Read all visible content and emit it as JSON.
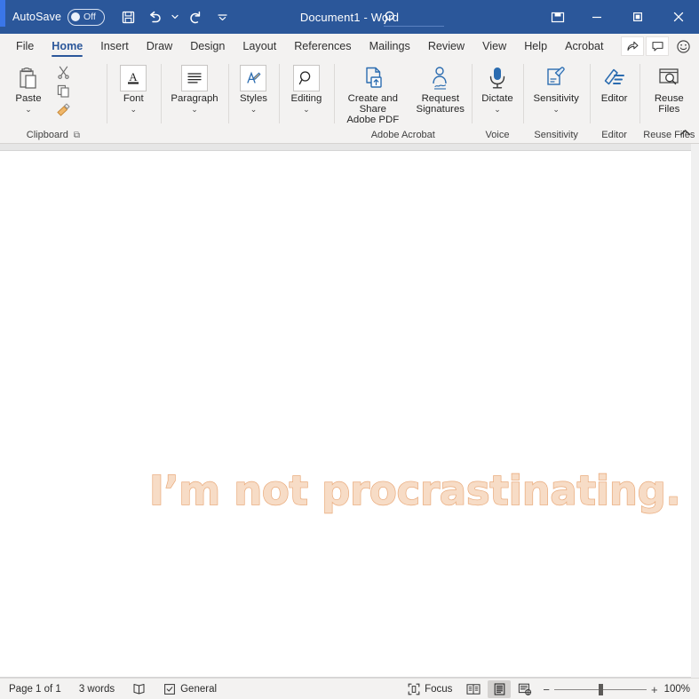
{
  "titlebar": {
    "autosave_label": "AutoSave",
    "autosave_state": "Off",
    "document_title": "Document1  -  Word",
    "quick_access": [
      {
        "name": "save-button",
        "icon": "save-icon"
      },
      {
        "name": "undo-button",
        "icon": "undo-icon"
      },
      {
        "name": "redo-button",
        "icon": "redo-icon"
      },
      {
        "name": "customize-quick-access-button",
        "icon": "chevron-down-icon"
      }
    ],
    "search_icon": "search-icon",
    "window_controls": [
      {
        "name": "ribbon-display-options-button",
        "icon": "ribbon-display-icon"
      },
      {
        "name": "minimize-button",
        "icon": "minimize-icon"
      },
      {
        "name": "maximize-button",
        "icon": "maximize-icon"
      },
      {
        "name": "close-button",
        "icon": "close-icon"
      }
    ]
  },
  "tabs": [
    {
      "label": "File",
      "active": false
    },
    {
      "label": "Home",
      "active": true
    },
    {
      "label": "Insert",
      "active": false
    },
    {
      "label": "Draw",
      "active": false
    },
    {
      "label": "Design",
      "active": false
    },
    {
      "label": "Layout",
      "active": false
    },
    {
      "label": "References",
      "active": false
    },
    {
      "label": "Mailings",
      "active": false
    },
    {
      "label": "Review",
      "active": false
    },
    {
      "label": "View",
      "active": false
    },
    {
      "label": "Help",
      "active": false
    },
    {
      "label": "Acrobat",
      "active": false
    }
  ],
  "tabbar_right": [
    {
      "name": "share-button",
      "icon": "share-icon"
    },
    {
      "name": "comments-button",
      "icon": "comment-icon"
    },
    {
      "name": "feedback-button",
      "icon": "smiley-icon"
    }
  ],
  "ribbon": {
    "collapse_icon": "chevron-up-icon",
    "groups": [
      {
        "name": "clipboard",
        "label": "Clipboard",
        "launcher": true,
        "buttons": [
          {
            "name": "paste-button",
            "label": "Paste",
            "icon": "paste-icon",
            "caret": true
          },
          {
            "name": "cut-button",
            "label": "",
            "icon": "scissors-icon",
            "caret": false
          },
          {
            "name": "copy-button",
            "label": "",
            "icon": "copy-icon",
            "caret": false
          },
          {
            "name": "format-painter-button",
            "label": "",
            "icon": "format-painter-icon",
            "caret": false
          }
        ]
      },
      {
        "name": "font",
        "label": "",
        "launcher": false,
        "buttons": [
          {
            "name": "font-group-button",
            "label": "Font",
            "icon": "font-a-icon",
            "caret": true
          }
        ]
      },
      {
        "name": "paragraph",
        "label": "",
        "launcher": false,
        "buttons": [
          {
            "name": "paragraph-group-button",
            "label": "Paragraph",
            "icon": "paragraph-lines-icon",
            "caret": true
          }
        ]
      },
      {
        "name": "styles",
        "label": "",
        "launcher": false,
        "buttons": [
          {
            "name": "styles-group-button",
            "label": "Styles",
            "icon": "styles-pen-icon",
            "caret": true
          }
        ]
      },
      {
        "name": "editing",
        "label": "",
        "launcher": false,
        "buttons": [
          {
            "name": "editing-group-button",
            "label": "Editing",
            "icon": "magnifier-icon",
            "caret": true
          }
        ]
      },
      {
        "name": "adobe-acrobat",
        "label": "Adobe Acrobat",
        "launcher": false,
        "buttons": [
          {
            "name": "create-and-share-adobe-pdf-button",
            "label": "Create and Share\nAdobe PDF",
            "icon": "pdf-upload-icon",
            "caret": false
          },
          {
            "name": "request-signatures-button",
            "label": "Request\nSignatures",
            "icon": "signature-person-icon",
            "caret": false
          }
        ]
      },
      {
        "name": "voice",
        "label": "Voice",
        "launcher": false,
        "buttons": [
          {
            "name": "dictate-button",
            "label": "Dictate",
            "icon": "microphone-icon",
            "caret": true
          }
        ]
      },
      {
        "name": "sensitivity",
        "label": "Sensitivity",
        "launcher": false,
        "buttons": [
          {
            "name": "sensitivity-button",
            "label": "Sensitivity",
            "icon": "sensitivity-tag-icon",
            "caret": true
          }
        ]
      },
      {
        "name": "editor",
        "label": "Editor",
        "launcher": false,
        "buttons": [
          {
            "name": "editor-button",
            "label": "Editor",
            "icon": "editor-pen-icon",
            "caret": false
          }
        ]
      },
      {
        "name": "reuse-files",
        "label": "Reuse Files",
        "launcher": false,
        "buttons": [
          {
            "name": "reuse-files-button",
            "label": "Reuse\nFiles",
            "icon": "reuse-files-icon",
            "caret": false
          }
        ]
      }
    ]
  },
  "document": {
    "body_text": "I’m not procrastinating.",
    "text_fill_color": "#f7dcc6",
    "text_outline_color": "#e9a979"
  },
  "statusbar": {
    "page_info": "Page 1 of 1",
    "word_count": "3 words",
    "proofing_icon": "proofing-book-icon",
    "sensitivity_icon": "sensitivity-label-icon",
    "sensitivity_label": "General",
    "focus_icon": "focus-icon",
    "focus_label": "Focus",
    "views": [
      {
        "name": "read-mode-button",
        "icon": "read-mode-icon",
        "selected": false
      },
      {
        "name": "print-layout-button",
        "icon": "print-layout-icon",
        "selected": true
      },
      {
        "name": "web-layout-button",
        "icon": "web-layout-icon",
        "selected": false
      }
    ],
    "zoom_out": "−",
    "zoom_in": "+",
    "zoom_level": "100%"
  }
}
